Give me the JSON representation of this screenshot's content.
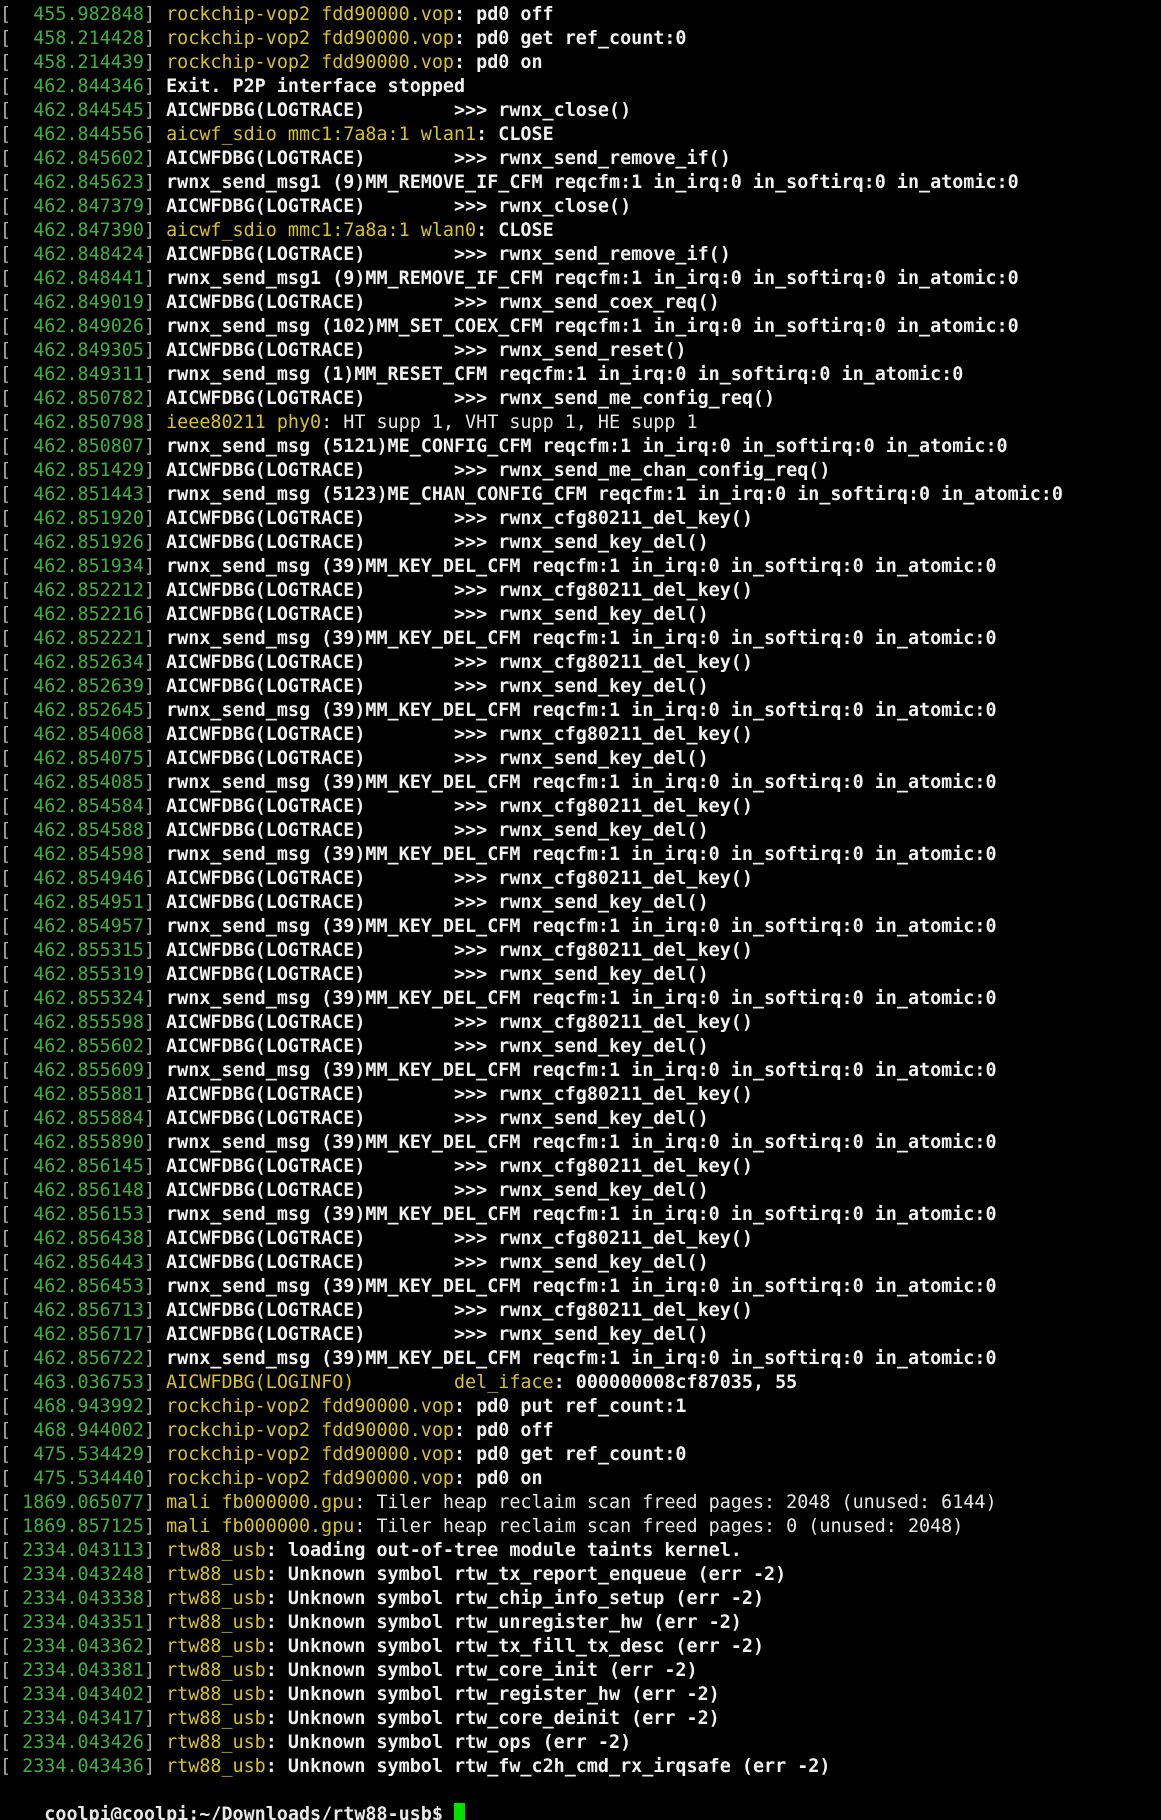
{
  "colors": {
    "background": "#000000",
    "timestamp": "#3bb33b",
    "device_prefix": "#d8c322",
    "message": "#f2f2f2",
    "cursor": "#00e000"
  },
  "log_lines": [
    {
      "ts": "  455.982848",
      "dev": "rockchip-vop2 fdd90000.vop",
      "msg": ": pd0 off"
    },
    {
      "ts": "  458.214428",
      "dev": "rockchip-vop2 fdd90000.vop",
      "msg": ": pd0 get ref_count:0"
    },
    {
      "ts": "  458.214439",
      "dev": "rockchip-vop2 fdd90000.vop",
      "msg": ": pd0 on"
    },
    {
      "ts": "  462.844346",
      "dev": "",
      "msg": "Exit. P2P interface stopped"
    },
    {
      "ts": "  462.844545",
      "dev": "",
      "msg": "AICWFDBG(LOGTRACE)        >>> rwnx_close()"
    },
    {
      "ts": "  462.844556",
      "dev": "aicwf_sdio mmc1:7a8a:1 wlan1",
      "msg": ": CLOSE"
    },
    {
      "ts": "  462.845602",
      "dev": "",
      "msg": "AICWFDBG(LOGTRACE)        >>> rwnx_send_remove_if()"
    },
    {
      "ts": "  462.845623",
      "dev": "",
      "msg": "rwnx_send_msg1 (9)MM_REMOVE_IF_CFM reqcfm:1 in_irq:0 in_softirq:0 in_atomic:0"
    },
    {
      "ts": "  462.847379",
      "dev": "",
      "msg": "AICWFDBG(LOGTRACE)        >>> rwnx_close()"
    },
    {
      "ts": "  462.847390",
      "dev": "aicwf_sdio mmc1:7a8a:1 wlan0",
      "msg": ": CLOSE"
    },
    {
      "ts": "  462.848424",
      "dev": "",
      "msg": "AICWFDBG(LOGTRACE)        >>> rwnx_send_remove_if()"
    },
    {
      "ts": "  462.848441",
      "dev": "",
      "msg": "rwnx_send_msg1 (9)MM_REMOVE_IF_CFM reqcfm:1 in_irq:0 in_softirq:0 in_atomic:0"
    },
    {
      "ts": "  462.849019",
      "dev": "",
      "msg": "AICWFDBG(LOGTRACE)        >>> rwnx_send_coex_req()"
    },
    {
      "ts": "  462.849026",
      "dev": "",
      "msg": "rwnx_send_msg (102)MM_SET_COEX_CFM reqcfm:1 in_irq:0 in_softirq:0 in_atomic:0"
    },
    {
      "ts": "  462.849305",
      "dev": "",
      "msg": "AICWFDBG(LOGTRACE)        >>> rwnx_send_reset()"
    },
    {
      "ts": "  462.849311",
      "dev": "",
      "msg": "rwnx_send_msg (1)MM_RESET_CFM reqcfm:1 in_irq:0 in_softirq:0 in_atomic:0"
    },
    {
      "ts": "  462.850782",
      "dev": "",
      "msg": "AICWFDBG(LOGTRACE)        >>> rwnx_send_me_config_req()"
    },
    {
      "ts": "  462.850798",
      "dev": "ieee80211 phy0",
      "msg": ": HT supp 1, VHT supp 1, HE supp 1",
      "plain": true
    },
    {
      "ts": "  462.850807",
      "dev": "",
      "msg": "rwnx_send_msg (5121)ME_CONFIG_CFM reqcfm:1 in_irq:0 in_softirq:0 in_atomic:0"
    },
    {
      "ts": "  462.851429",
      "dev": "",
      "msg": "AICWFDBG(LOGTRACE)        >>> rwnx_send_me_chan_config_req()"
    },
    {
      "ts": "  462.851443",
      "dev": "",
      "msg": "rwnx_send_msg (5123)ME_CHAN_CONFIG_CFM reqcfm:1 in_irq:0 in_softirq:0 in_atomic:0"
    },
    {
      "ts": "  462.851920",
      "dev": "",
      "msg": "AICWFDBG(LOGTRACE)        >>> rwnx_cfg80211_del_key()"
    },
    {
      "ts": "  462.851926",
      "dev": "",
      "msg": "AICWFDBG(LOGTRACE)        >>> rwnx_send_key_del()"
    },
    {
      "ts": "  462.851934",
      "dev": "",
      "msg": "rwnx_send_msg (39)MM_KEY_DEL_CFM reqcfm:1 in_irq:0 in_softirq:0 in_atomic:0"
    },
    {
      "ts": "  462.852212",
      "dev": "",
      "msg": "AICWFDBG(LOGTRACE)        >>> rwnx_cfg80211_del_key()"
    },
    {
      "ts": "  462.852216",
      "dev": "",
      "msg": "AICWFDBG(LOGTRACE)        >>> rwnx_send_key_del()"
    },
    {
      "ts": "  462.852221",
      "dev": "",
      "msg": "rwnx_send_msg (39)MM_KEY_DEL_CFM reqcfm:1 in_irq:0 in_softirq:0 in_atomic:0"
    },
    {
      "ts": "  462.852634",
      "dev": "",
      "msg": "AICWFDBG(LOGTRACE)        >>> rwnx_cfg80211_del_key()"
    },
    {
      "ts": "  462.852639",
      "dev": "",
      "msg": "AICWFDBG(LOGTRACE)        >>> rwnx_send_key_del()"
    },
    {
      "ts": "  462.852645",
      "dev": "",
      "msg": "rwnx_send_msg (39)MM_KEY_DEL_CFM reqcfm:1 in_irq:0 in_softirq:0 in_atomic:0"
    },
    {
      "ts": "  462.854068",
      "dev": "",
      "msg": "AICWFDBG(LOGTRACE)        >>> rwnx_cfg80211_del_key()"
    },
    {
      "ts": "  462.854075",
      "dev": "",
      "msg": "AICWFDBG(LOGTRACE)        >>> rwnx_send_key_del()"
    },
    {
      "ts": "  462.854085",
      "dev": "",
      "msg": "rwnx_send_msg (39)MM_KEY_DEL_CFM reqcfm:1 in_irq:0 in_softirq:0 in_atomic:0"
    },
    {
      "ts": "  462.854584",
      "dev": "",
      "msg": "AICWFDBG(LOGTRACE)        >>> rwnx_cfg80211_del_key()"
    },
    {
      "ts": "  462.854588",
      "dev": "",
      "msg": "AICWFDBG(LOGTRACE)        >>> rwnx_send_key_del()"
    },
    {
      "ts": "  462.854598",
      "dev": "",
      "msg": "rwnx_send_msg (39)MM_KEY_DEL_CFM reqcfm:1 in_irq:0 in_softirq:0 in_atomic:0"
    },
    {
      "ts": "  462.854946",
      "dev": "",
      "msg": "AICWFDBG(LOGTRACE)        >>> rwnx_cfg80211_del_key()"
    },
    {
      "ts": "  462.854951",
      "dev": "",
      "msg": "AICWFDBG(LOGTRACE)        >>> rwnx_send_key_del()"
    },
    {
      "ts": "  462.854957",
      "dev": "",
      "msg": "rwnx_send_msg (39)MM_KEY_DEL_CFM reqcfm:1 in_irq:0 in_softirq:0 in_atomic:0"
    },
    {
      "ts": "  462.855315",
      "dev": "",
      "msg": "AICWFDBG(LOGTRACE)        >>> rwnx_cfg80211_del_key()"
    },
    {
      "ts": "  462.855319",
      "dev": "",
      "msg": "AICWFDBG(LOGTRACE)        >>> rwnx_send_key_del()"
    },
    {
      "ts": "  462.855324",
      "dev": "",
      "msg": "rwnx_send_msg (39)MM_KEY_DEL_CFM reqcfm:1 in_irq:0 in_softirq:0 in_atomic:0"
    },
    {
      "ts": "  462.855598",
      "dev": "",
      "msg": "AICWFDBG(LOGTRACE)        >>> rwnx_cfg80211_del_key()"
    },
    {
      "ts": "  462.855602",
      "dev": "",
      "msg": "AICWFDBG(LOGTRACE)        >>> rwnx_send_key_del()"
    },
    {
      "ts": "  462.855609",
      "dev": "",
      "msg": "rwnx_send_msg (39)MM_KEY_DEL_CFM reqcfm:1 in_irq:0 in_softirq:0 in_atomic:0"
    },
    {
      "ts": "  462.855881",
      "dev": "",
      "msg": "AICWFDBG(LOGTRACE)        >>> rwnx_cfg80211_del_key()"
    },
    {
      "ts": "  462.855884",
      "dev": "",
      "msg": "AICWFDBG(LOGTRACE)        >>> rwnx_send_key_del()"
    },
    {
      "ts": "  462.855890",
      "dev": "",
      "msg": "rwnx_send_msg (39)MM_KEY_DEL_CFM reqcfm:1 in_irq:0 in_softirq:0 in_atomic:0"
    },
    {
      "ts": "  462.856145",
      "dev": "",
      "msg": "AICWFDBG(LOGTRACE)        >>> rwnx_cfg80211_del_key()"
    },
    {
      "ts": "  462.856148",
      "dev": "",
      "msg": "AICWFDBG(LOGTRACE)        >>> rwnx_send_key_del()"
    },
    {
      "ts": "  462.856153",
      "dev": "",
      "msg": "rwnx_send_msg (39)MM_KEY_DEL_CFM reqcfm:1 in_irq:0 in_softirq:0 in_atomic:0"
    },
    {
      "ts": "  462.856438",
      "dev": "",
      "msg": "AICWFDBG(LOGTRACE)        >>> rwnx_cfg80211_del_key()"
    },
    {
      "ts": "  462.856443",
      "dev": "",
      "msg": "AICWFDBG(LOGTRACE)        >>> rwnx_send_key_del()"
    },
    {
      "ts": "  462.856453",
      "dev": "",
      "msg": "rwnx_send_msg (39)MM_KEY_DEL_CFM reqcfm:1 in_irq:0 in_softirq:0 in_atomic:0"
    },
    {
      "ts": "  462.856713",
      "dev": "",
      "msg": "AICWFDBG(LOGTRACE)        >>> rwnx_cfg80211_del_key()"
    },
    {
      "ts": "  462.856717",
      "dev": "",
      "msg": "AICWFDBG(LOGTRACE)        >>> rwnx_send_key_del()"
    },
    {
      "ts": "  462.856722",
      "dev": "",
      "msg": "rwnx_send_msg (39)MM_KEY_DEL_CFM reqcfm:1 in_irq:0 in_softirq:0 in_atomic:0"
    },
    {
      "ts": "  463.036753",
      "dev": "AICWFDBG(LOGINFO)         del_iface",
      "msg": ": 000000008cf87035, 55"
    },
    {
      "ts": "  468.943992",
      "dev": "rockchip-vop2 fdd90000.vop",
      "msg": ": pd0 put ref_count:1"
    },
    {
      "ts": "  468.944002",
      "dev": "rockchip-vop2 fdd90000.vop",
      "msg": ": pd0 off"
    },
    {
      "ts": "  475.534429",
      "dev": "rockchip-vop2 fdd90000.vop",
      "msg": ": pd0 get ref_count:0"
    },
    {
      "ts": "  475.534440",
      "dev": "rockchip-vop2 fdd90000.vop",
      "msg": ": pd0 on"
    },
    {
      "ts": " 1869.065077",
      "dev": "mali fb000000.gpu",
      "msg": ": Tiler heap reclaim scan freed pages: 2048 (unused: 6144)",
      "plain": true
    },
    {
      "ts": " 1869.857125",
      "dev": "mali fb000000.gpu",
      "msg": ": Tiler heap reclaim scan freed pages: 0 (unused: 2048)",
      "plain": true
    },
    {
      "ts": " 2334.043113",
      "dev": "rtw88_usb",
      "msg": ": loading out-of-tree module taints kernel."
    },
    {
      "ts": " 2334.043248",
      "dev": "rtw88_usb",
      "msg": ": Unknown symbol rtw_tx_report_enqueue (err -2)"
    },
    {
      "ts": " 2334.043338",
      "dev": "rtw88_usb",
      "msg": ": Unknown symbol rtw_chip_info_setup (err -2)"
    },
    {
      "ts": " 2334.043351",
      "dev": "rtw88_usb",
      "msg": ": Unknown symbol rtw_unregister_hw (err -2)"
    },
    {
      "ts": " 2334.043362",
      "dev": "rtw88_usb",
      "msg": ": Unknown symbol rtw_tx_fill_tx_desc (err -2)"
    },
    {
      "ts": " 2334.043381",
      "dev": "rtw88_usb",
      "msg": ": Unknown symbol rtw_core_init (err -2)"
    },
    {
      "ts": " 2334.043402",
      "dev": "rtw88_usb",
      "msg": ": Unknown symbol rtw_register_hw (err -2)"
    },
    {
      "ts": " 2334.043417",
      "dev": "rtw88_usb",
      "msg": ": Unknown symbol rtw_core_deinit (err -2)"
    },
    {
      "ts": " 2334.043426",
      "dev": "rtw88_usb",
      "msg": ": Unknown symbol rtw_ops (err -2)"
    },
    {
      "ts": " 2334.043436",
      "dev": "rtw88_usb",
      "msg": ": Unknown symbol rtw_fw_c2h_cmd_rx_irqsafe (err -2)"
    }
  ],
  "prompt": {
    "text": "coolpi@coolpi:~/Downloads/rtw88-usb$ "
  }
}
